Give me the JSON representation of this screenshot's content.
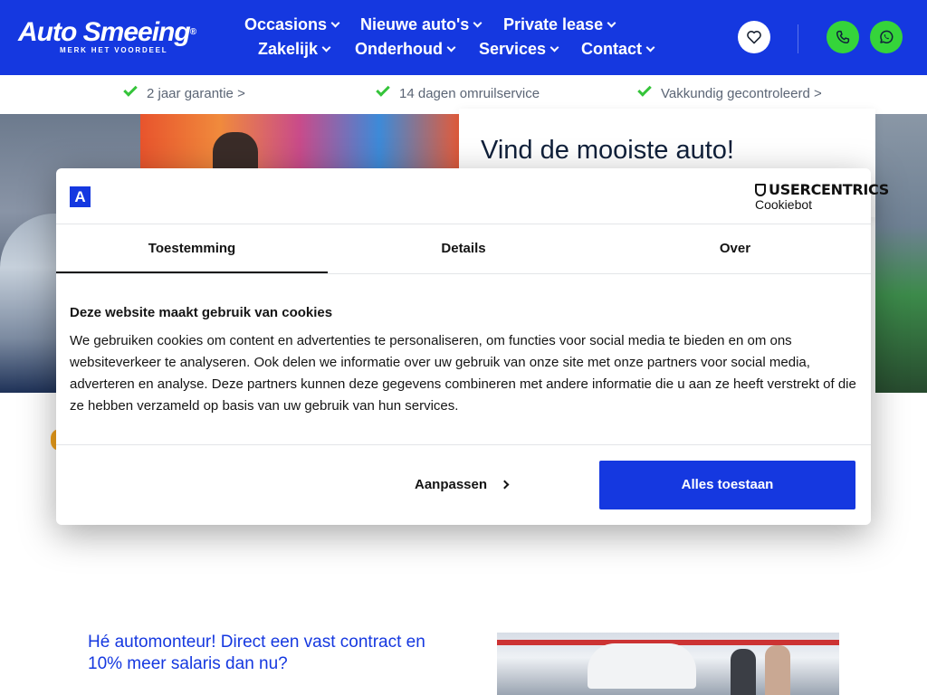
{
  "header": {
    "logo_main": "Auto Smeeing",
    "logo_reg": "®",
    "logo_tagline": "MERK HET VOORDEEL",
    "nav": [
      {
        "label": "Occasions"
      },
      {
        "label": "Nieuwe auto's"
      },
      {
        "label": "Private lease"
      },
      {
        "label": "Zakelijk"
      },
      {
        "label": "Onderhoud"
      },
      {
        "label": "Services"
      },
      {
        "label": "Contact"
      }
    ],
    "icons": {
      "favorites": "heart-icon",
      "call": "phone-icon",
      "whatsapp": "whatsapp-icon"
    },
    "colors": {
      "brand": "#1538e0",
      "accent_green": "#35d43a"
    }
  },
  "usps": [
    {
      "label": "2 jaar garantie >"
    },
    {
      "label": "14 dagen omruilservice"
    },
    {
      "label": "Vakkundig gecontroleerd >"
    }
  ],
  "hero": {
    "search_title": "Vind de mooiste auto!"
  },
  "cookie_dialog": {
    "logo_letter": "A",
    "provider_line1": "USERCENTRICS",
    "provider_line2": "Cookiebot",
    "tabs": [
      {
        "label": "Toestemming",
        "active": true
      },
      {
        "label": "Details",
        "active": false
      },
      {
        "label": "Over",
        "active": false
      }
    ],
    "heading": "Deze website maakt gebruik van cookies",
    "body": "We gebruiken cookies om content en advertenties te personaliseren, om functies voor social media te bieden en om ons websiteverkeer te analyseren. Ook delen we informatie over uw gebruik van onze site met onze partners voor social media, adverteren en analyse. Deze partners kunnen deze gegevens combineren met andere informatie die u aan ze heeft verstrekt of die ze hebben verzameld op basis van uw gebruik van hun services.",
    "customize_label": "Aanpassen",
    "allow_all_label": "Alles toestaan"
  },
  "content": {
    "job_title": "Hé automonteur! Direct een vast contract en 10% meer salaris dan nu?"
  }
}
